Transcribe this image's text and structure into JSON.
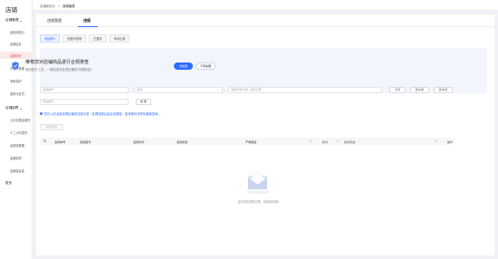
{
  "sidebar": {
    "logo": "店铺",
    "groups": [
      {
        "label": "店铺管理",
        "items": [
          "经营体检分",
          "店铺信息",
          "店铺评分",
          "子账号管理",
          "商家保护",
          "违规与处罚"
        ]
      },
      {
        "label": "店铺保障",
        "items": [
          "七天无理由退货",
          "十二小时发货",
          "运费险管理",
          "店铺资质",
          "店铺保证金"
        ]
      }
    ],
    "more": "更多",
    "active_item": "店铺评分"
  },
  "breadcrumb": {
    "parent": "店铺体检分",
    "separator": ">",
    "current": "违规管理"
  },
  "tabs": [
    {
      "label": "违规管理"
    },
    {
      "label": "违规"
    }
  ],
  "subtabs": [
    "待处理 0",
    "处理中违规",
    "已整改",
    "申诉记录"
  ],
  "banner": {
    "title": "推荐您对店铺商品进行合规排查",
    "subtitle": "使用官方工具，一键检查并处理近期的“问题商品”",
    "primary_button": "去检查",
    "secondary_button": "不再提醒"
  },
  "filters": {
    "row1": [
      {
        "placeholder": "违规编号"
      },
      {
        "placeholder": "类型"
      },
      {
        "placeholder": "违规开始日期 - 结束日期"
      }
    ],
    "quick_buttons": [
      "今天",
      "近30天",
      "近90天"
    ],
    "row2": [
      {
        "placeholder": "商品编号"
      }
    ],
    "search_button": "搜 索"
  },
  "notice": "您可以在此处查看店铺的违规记录，处理违规后会自动更新，如有疑问可联系客服咨询。",
  "bulk_button": "批量申诉",
  "table": {
    "columns": [
      "违规单号",
      "违规编号",
      "违规时间",
      "违规类型",
      "严重程度",
      "扣分",
      "处罚状态",
      "操作"
    ]
  },
  "empty_state": {
    "text": "当前没有违规记录，继续保持哦!"
  }
}
